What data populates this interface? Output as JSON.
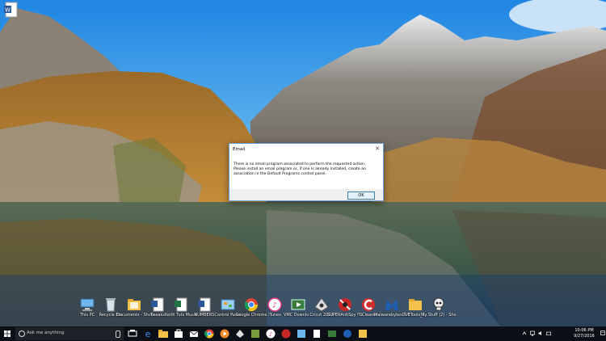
{
  "dialog": {
    "title": "Email",
    "close_glyph": "✕",
    "message": "There is no email program associated to perform the requested action. Please install an email program or, if one is already installed, create an association in the Default Programs control panel.",
    "ok_label": "OK"
  },
  "desktop_icons": [
    {
      "label": "This PC",
      "icon": "computer-icon"
    },
    {
      "label": "Recycle Bin",
      "icon": "recycle-bin-icon"
    },
    {
      "label": "Documents - Shortcut",
      "icon": "folder-icon"
    },
    {
      "label": "Tweaks",
      "icon": "word-document-icon"
    },
    {
      "label": "Keith Tuts Music",
      "icon": "excel-document-icon"
    },
    {
      "label": "NUMBERS",
      "icon": "word-document-icon"
    },
    {
      "label": "Control Panel",
      "icon": "control-panel-icon"
    },
    {
      "label": "Google Chrome",
      "icon": "chrome-icon"
    },
    {
      "label": "iTunes",
      "icon": "itunes-icon"
    },
    {
      "label": "VMC Downlo...",
      "icon": "media-center-icon"
    },
    {
      "label": "Cricut 2000",
      "icon": "app-icon"
    },
    {
      "label": "SUPERAntiSpy Free Edition",
      "icon": "antispyware-icon"
    },
    {
      "label": "CCleaner",
      "icon": "ccleaner-icon"
    },
    {
      "label": "Malwarebytes Anti-Malware",
      "icon": "malwarebytes-icon"
    },
    {
      "label": "CUETools_2...",
      "icon": "folder-icon"
    },
    {
      "label": "My Stuff (2) - Shortcut",
      "icon": "skull-icon"
    }
  ],
  "taskbar": {
    "search_placeholder": "Ask me anything",
    "pinned": [
      "task-view-icon",
      "edge-icon",
      "file-explorer-icon",
      "store-icon",
      "mail-icon",
      "chrome-icon",
      "media-player-icon",
      "app-icon",
      "app-icon",
      "itunes-icon",
      "app-icon",
      "app-icon",
      "app-icon",
      "app-icon",
      "app-icon"
    ],
    "time": "10:06 PM",
    "date": "9/27/2016"
  },
  "colors": {
    "taskbar_bg": "#0c1016",
    "dialog_border": "#6aa0d8",
    "button_border": "#3c7fb1",
    "sky": "#2f8fe0"
  }
}
